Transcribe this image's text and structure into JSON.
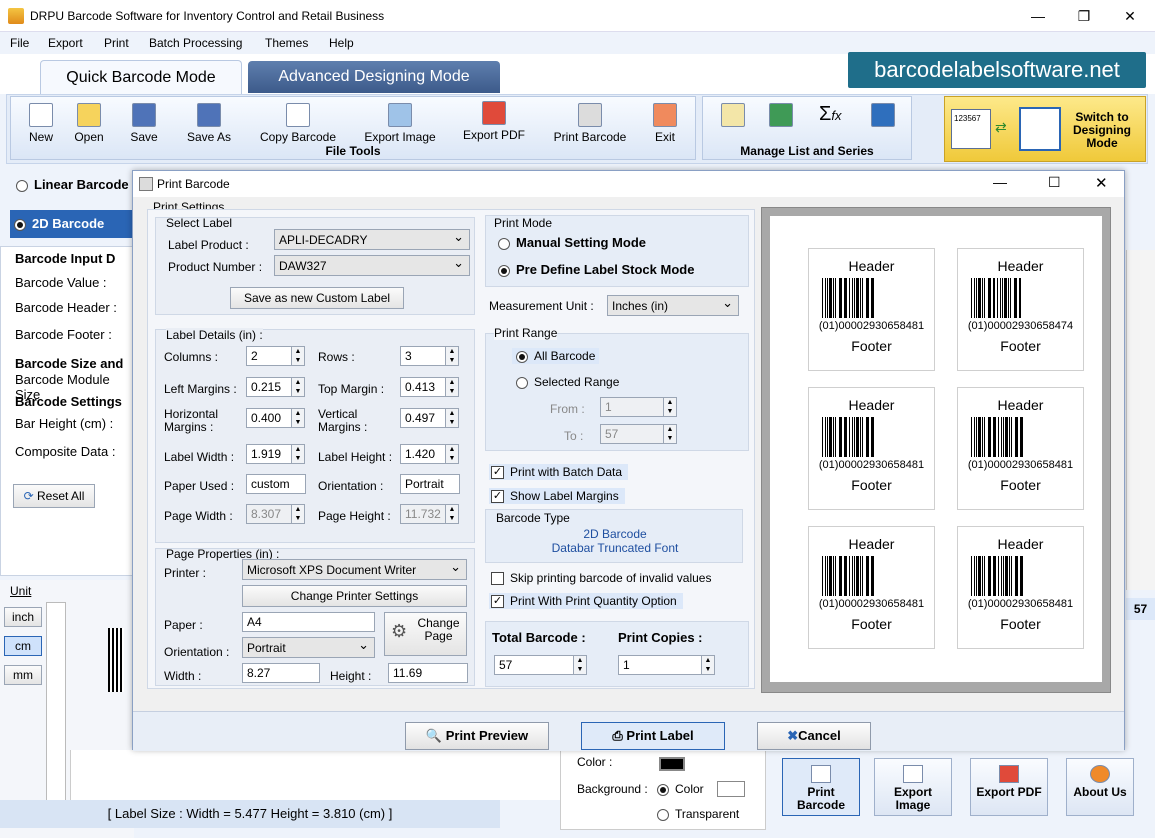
{
  "window": {
    "title": "DRPU Barcode Software for Inventory Control and Retail Business"
  },
  "menu": [
    "File",
    "Export",
    "Print",
    "Batch Processing",
    "Themes",
    "Help"
  ],
  "tabs": {
    "quick": "Quick Barcode Mode",
    "advanced": "Advanced Designing Mode"
  },
  "site": "barcodelabelsoftware.net",
  "toolbar": {
    "file_tools": [
      "New",
      "Open",
      "Save",
      "Save As",
      "Copy Barcode",
      "Export Image",
      "Export PDF",
      "Print Barcode",
      "Exit"
    ],
    "file_tools_label": "File Tools",
    "manage_label": "Manage List and Series",
    "switch_label": "Switch to Designing Mode",
    "switch_sample": "123567"
  },
  "left": {
    "linear": "Linear Barcode",
    "twod": "2D Barcode",
    "input_title": "Barcode Input D",
    "value": "Barcode Value :",
    "header": "Barcode Header :",
    "footer": "Barcode Footer :",
    "size_title": "Barcode Size and",
    "module": "Barcode Module Size",
    "settings_title": "Barcode Settings",
    "bar_height": "Bar Height (cm) :",
    "composite": "Composite Data :",
    "reset": "Reset All",
    "unit": "Unit",
    "units": [
      "inch",
      "cm",
      "mm"
    ]
  },
  "status": "[ Label Size : Width = 5.477  Height = 3.810 (cm) ]",
  "right_side": {
    "value57": "57",
    "color": "Color :",
    "background": "Background :",
    "bg_color": "Color",
    "transparent": "Transparent"
  },
  "bottom_tiles": [
    "Print Barcode",
    "Export Image",
    "Export PDF",
    "About Us"
  ],
  "dialog": {
    "title": "Print Barcode",
    "print_settings": "Print Settings",
    "select_label": "Select Label",
    "label_product": "Label Product :",
    "label_product_val": "APLI-DECADRY",
    "product_number": "Product Number :",
    "product_number_val": "DAW327",
    "save_custom": "Save as new Custom Label",
    "label_details": "Label Details (in) :",
    "columns": "Columns :",
    "columns_val": "2",
    "rows": "Rows :",
    "rows_val": "3",
    "left_margins": "Left Margins :",
    "left_margins_val": "0.215",
    "top_margin": "Top Margin :",
    "top_margin_val": "0.413",
    "h_margins1": "Horizontal",
    "h_margins2": "Margins :",
    "h_margins_val": "0.400",
    "v_margins1": "Vertical",
    "v_margins2": "Margins :",
    "v_margins_val": "0.497",
    "label_width": "Label Width :",
    "label_width_val": "1.919",
    "label_height": "Label Height :",
    "label_height_val": "1.420",
    "paper_used": "Paper Used :",
    "paper_used_val": "custom",
    "orientation": "Orientation :",
    "orientation_val": "Portrait",
    "page_width": "Page Width :",
    "page_width_val": "8.307",
    "page_height": "Page Height :",
    "page_height_val": "11.732",
    "page_props": "Page Properties (in) :",
    "printer": "Printer :",
    "printer_val": "Microsoft XPS Document Writer",
    "change_printer": "Change Printer Settings",
    "paper": "Paper :",
    "paper_val": "A4",
    "orient2": "Orientation :",
    "orient2_val": "Portrait",
    "change_page": "Change Page",
    "width": "Width :",
    "width_val": "8.27",
    "height": "Height :",
    "height_val": "11.69",
    "print_mode": "Print Mode",
    "manual": "Manual Setting Mode",
    "predefine": "Pre Define Label Stock Mode",
    "measure": "Measurement Unit :",
    "measure_val": "Inches (in)",
    "print_range": "Print Range",
    "all_barcode": "All Barcode",
    "selected_range": "Selected Range",
    "from": "From :",
    "from_val": "1",
    "to": "To :",
    "to_val": "57",
    "batch": "Print with Batch Data",
    "show_margins": "Show Label Margins",
    "barcode_type": "Barcode Type",
    "type1": "2D Barcode",
    "type2": "Databar Truncated Font",
    "skip": "Skip printing barcode of invalid values",
    "quantity": "Print With Print Quantity Option",
    "total": "Total Barcode :",
    "total_val": "57",
    "copies": "Print Copies :",
    "copies_val": "1",
    "preview_btn": "Print Preview",
    "print_btn": "Print Label",
    "cancel_btn": "Cancel"
  },
  "labels": [
    {
      "header": "Header",
      "number": "(01)00002930658481",
      "footer": "Footer"
    },
    {
      "header": "Header",
      "number": "(01)00002930658474",
      "footer": "Footer"
    },
    {
      "header": "Header",
      "number": "(01)00002930658481",
      "footer": "Footer"
    },
    {
      "header": "Header",
      "number": "(01)00002930658481",
      "footer": "Footer"
    },
    {
      "header": "Header",
      "number": "(01)00002930658481",
      "footer": "Footer"
    },
    {
      "header": "Header",
      "number": "(01)00002930658481",
      "footer": "Footer"
    }
  ]
}
